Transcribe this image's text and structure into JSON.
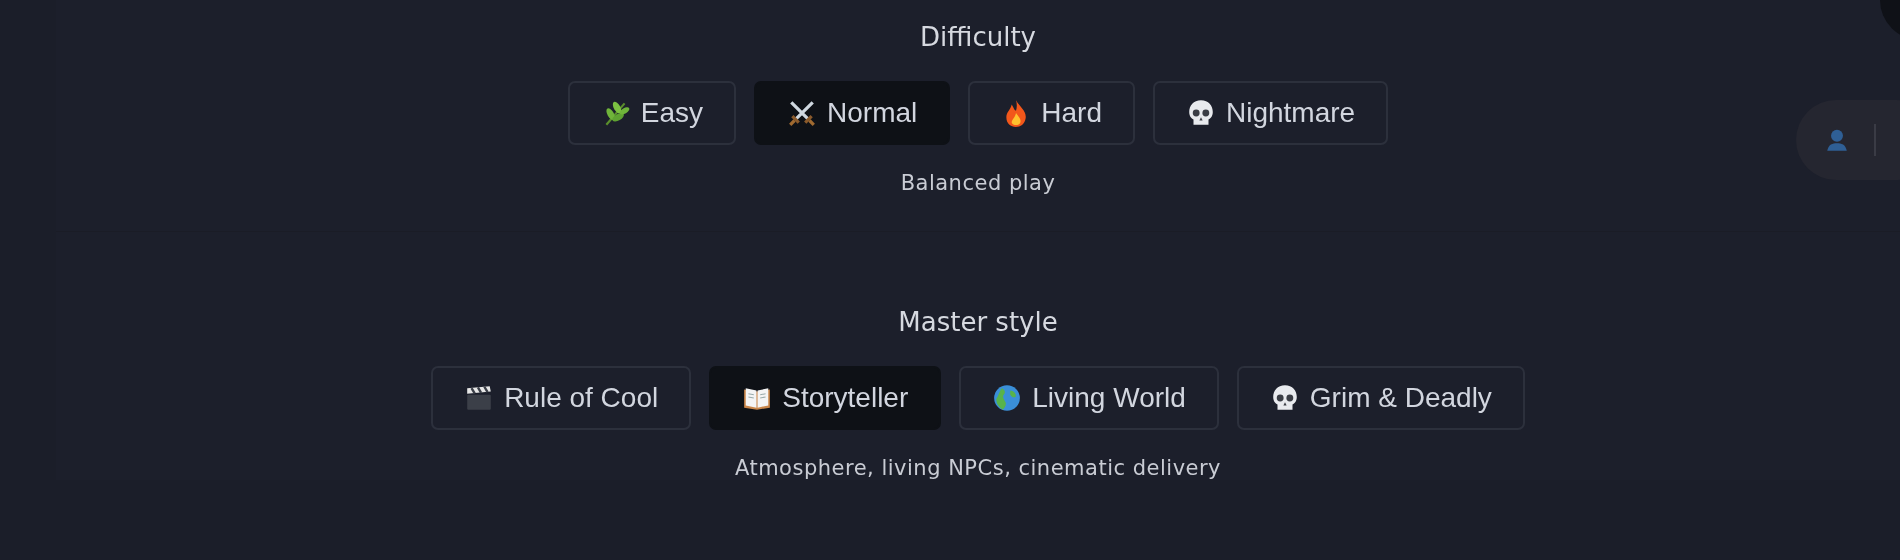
{
  "sections": [
    {
      "title": "Difficulty",
      "options": [
        {
          "label": "Easy",
          "selected": false
        },
        {
          "label": "Normal",
          "selected": true
        },
        {
          "label": "Hard",
          "selected": false
        },
        {
          "label": "Nightmare",
          "selected": false
        }
      ],
      "description": "Balanced play"
    },
    {
      "title": "Master style",
      "options": [
        {
          "label": "Rule of Cool",
          "selected": false
        },
        {
          "label": "Storyteller",
          "selected": true
        },
        {
          "label": "Living World",
          "selected": false
        },
        {
          "label": "Grim & Deadly",
          "selected": false
        }
      ],
      "description": "Atmosphere, living NPCs, cinematic delivery"
    }
  ]
}
